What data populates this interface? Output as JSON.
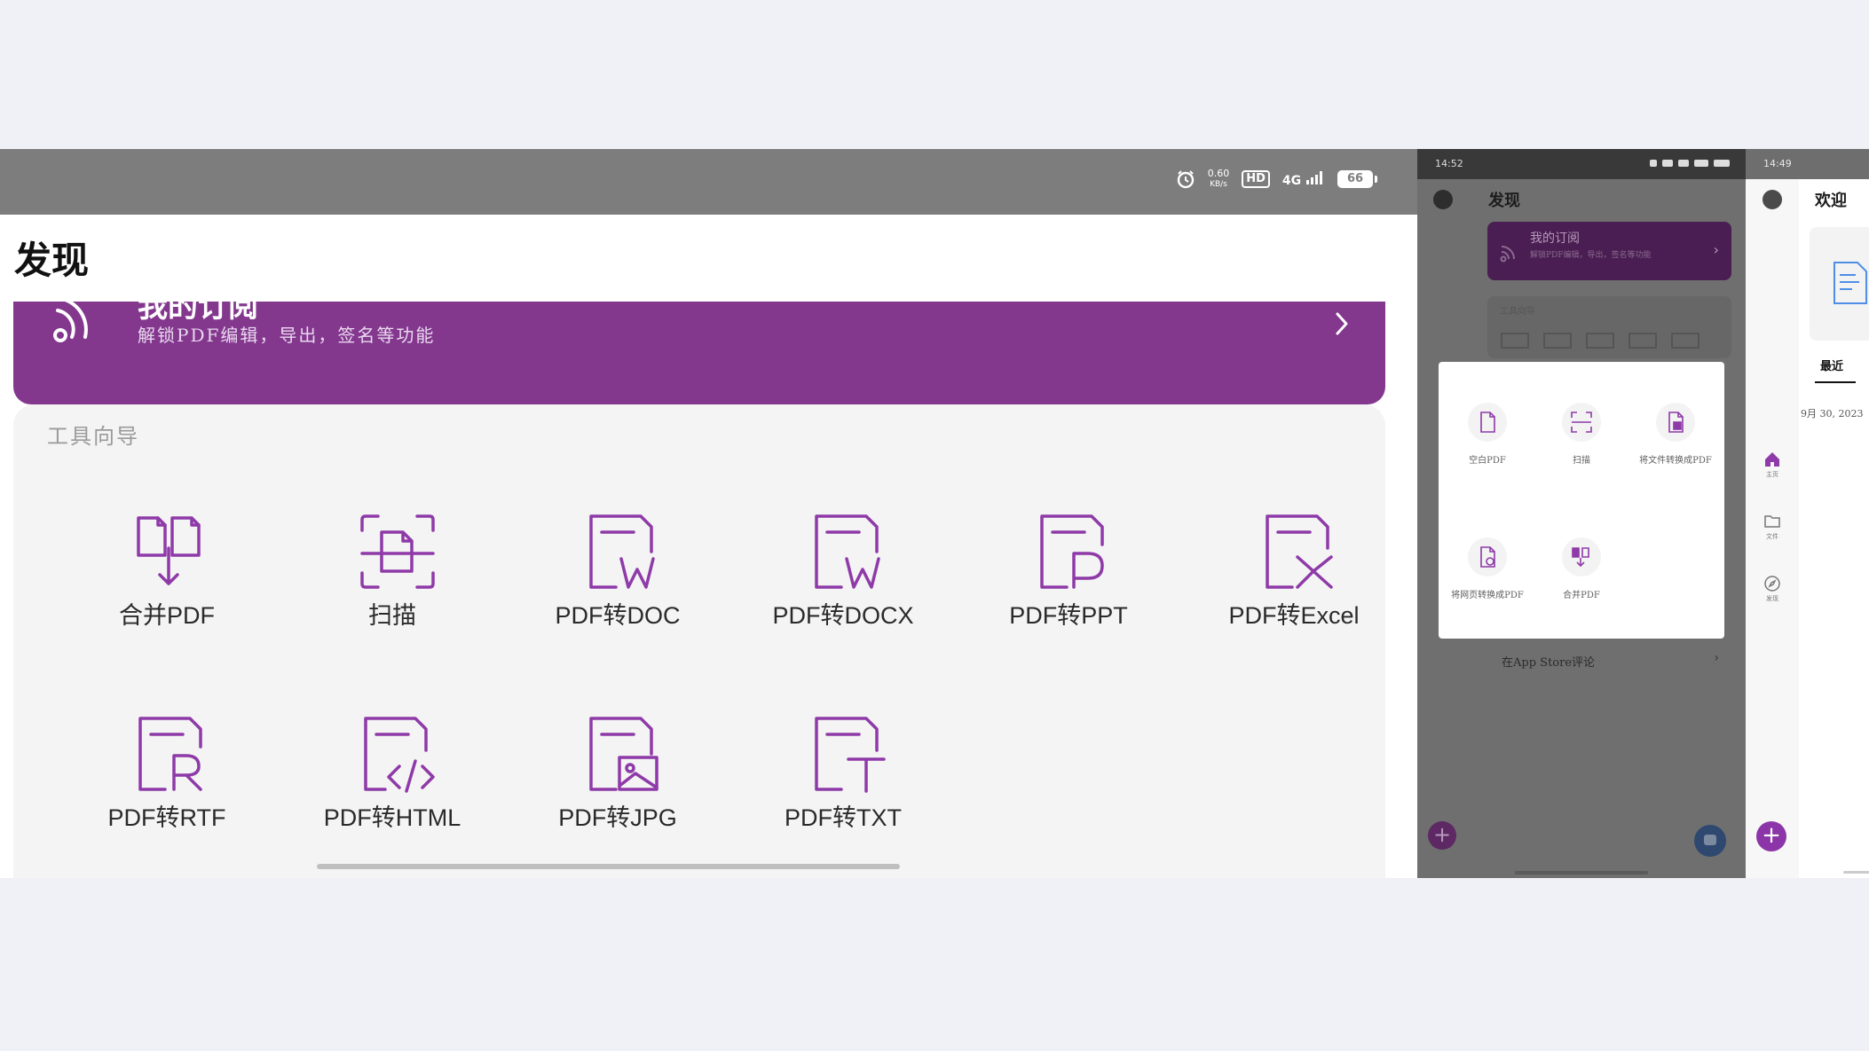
{
  "colors": {
    "brand_purple": "#83388e",
    "icon_purple": "#8e3aa8",
    "fab_blue": "#4f8ee6",
    "status_bar_gray": "#7d7d7d",
    "card_bg": "#f4f4f4",
    "page_bg": "#eff1f7"
  },
  "main": {
    "status": {
      "speed_value": "0.60",
      "speed_unit": "KB/s",
      "hd_badge": "HD",
      "network": "4G",
      "battery": "66",
      "icons": [
        "alarm-icon",
        "hd-icon",
        "signal-icon",
        "battery-icon"
      ]
    },
    "title": "发现",
    "subscription": {
      "title": "我的订阅",
      "description": "解锁PDF编辑，导出，签名等功能",
      "icon": "rss-icon",
      "chevron": "chevron-right-icon"
    },
    "tools_label": "工具向导",
    "tools": [
      {
        "label": "合并PDF",
        "icon": "merge-pdf-icon"
      },
      {
        "label": "扫描",
        "icon": "scan-icon"
      },
      {
        "label": "PDF转DOC",
        "icon": "pdf-to-doc-icon"
      },
      {
        "label": "PDF转DOCX",
        "icon": "pdf-to-docx-icon"
      },
      {
        "label": "PDF转PPT",
        "icon": "pdf-to-ppt-icon"
      },
      {
        "label": "PDF转Excel",
        "icon": "pdf-to-excel-icon"
      },
      {
        "label": "PDF转RTF",
        "icon": "pdf-to-rtf-icon"
      },
      {
        "label": "PDF转HTML",
        "icon": "pdf-to-html-icon"
      },
      {
        "label": "PDF转JPG",
        "icon": "pdf-to-jpg-icon"
      },
      {
        "label": "PDF转TXT",
        "icon": "pdf-to-txt-icon"
      }
    ],
    "fab_icon": "chat-icon"
  },
  "mid": {
    "time": "14:52",
    "title": "发现",
    "subscription_title": "我的订阅",
    "subscription_desc": "解锁PDF编辑，导出，签名等功能",
    "tools_label": "工具向导",
    "sheet_items": [
      {
        "label": "空白PDF",
        "icon": "blank-pdf-icon"
      },
      {
        "label": "扫描",
        "icon": "scan-icon"
      },
      {
        "label": "将文件转换成PDF",
        "icon": "file-to-pdf-icon"
      },
      {
        "label": "将网页转换成PDF",
        "icon": "web-to-pdf-icon"
      },
      {
        "label": "合并PDF",
        "icon": "merge-pdf-icon"
      }
    ],
    "review_label": "在App Store评论",
    "plus_label": "+"
  },
  "right": {
    "time": "14:49",
    "title": "欢迎",
    "tab_recent": "最近",
    "date": "9月 30, 2023",
    "rail": [
      {
        "label": "主页",
        "icon": "home-icon"
      },
      {
        "label": "文件",
        "icon": "folder-icon"
      },
      {
        "label": "发现",
        "icon": "compass-icon"
      }
    ],
    "plus_label": "+"
  }
}
